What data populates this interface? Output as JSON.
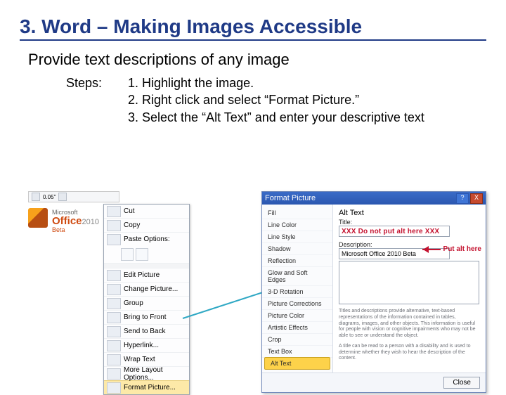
{
  "title": "3. Word – Making Images Accessible",
  "subtitle": "Provide text descriptions of any image",
  "steps_label": "Steps:",
  "steps": {
    "s1": "1. Highlight the image.",
    "s2": "2. Right click and select “Format Picture.”",
    "s3": "3. Select the “Alt Text” and enter your descriptive text"
  },
  "office_logo": {
    "brand_small": "Microsoft",
    "brand": "Office",
    "year": "2010",
    "beta": "Beta"
  },
  "ribbon_height": "0.05\"",
  "context_menu": {
    "cut": "Cut",
    "copy": "Copy",
    "paste_label": "Paste Options:",
    "edit": "Edit Picture",
    "change": "Change Picture...",
    "group": "Group",
    "front": "Bring to Front",
    "back": "Send to Back",
    "hyper": "Hyperlink...",
    "wrap": "Wrap Text",
    "more": "More Layout Options...",
    "format": "Format Picture..."
  },
  "dialog": {
    "title": "Format Picture",
    "nav": {
      "fill": "Fill",
      "line_color": "Line Color",
      "line_style": "Line Style",
      "shadow": "Shadow",
      "reflection": "Reflection",
      "glow": "Glow and Soft Edges",
      "rot": "3-D Rotation",
      "corr": "Picture Corrections",
      "color": "Picture Color",
      "art": "Artistic Effects",
      "crop": "Crop",
      "textbox": "Text Box",
      "alt": "Alt Text"
    },
    "pane_heading": "Alt Text",
    "title_label": "Title:",
    "title_value": "XXX Do not put alt here XXX",
    "desc_label": "Description:",
    "desc_value": "Microsoft Office 2010 Beta",
    "put_here": "Put alt here",
    "hint1": "Titles and descriptions provide alternative, text-based representations of the information contained in tables, diagrams, images, and other objects. This information is useful for people with vision or cognitive impairments who may not be able to see or understand the object.",
    "hint2": "A title can be read to a person with a disability and is used to determine whether they wish to hear the description of the content.",
    "close": "Close"
  }
}
